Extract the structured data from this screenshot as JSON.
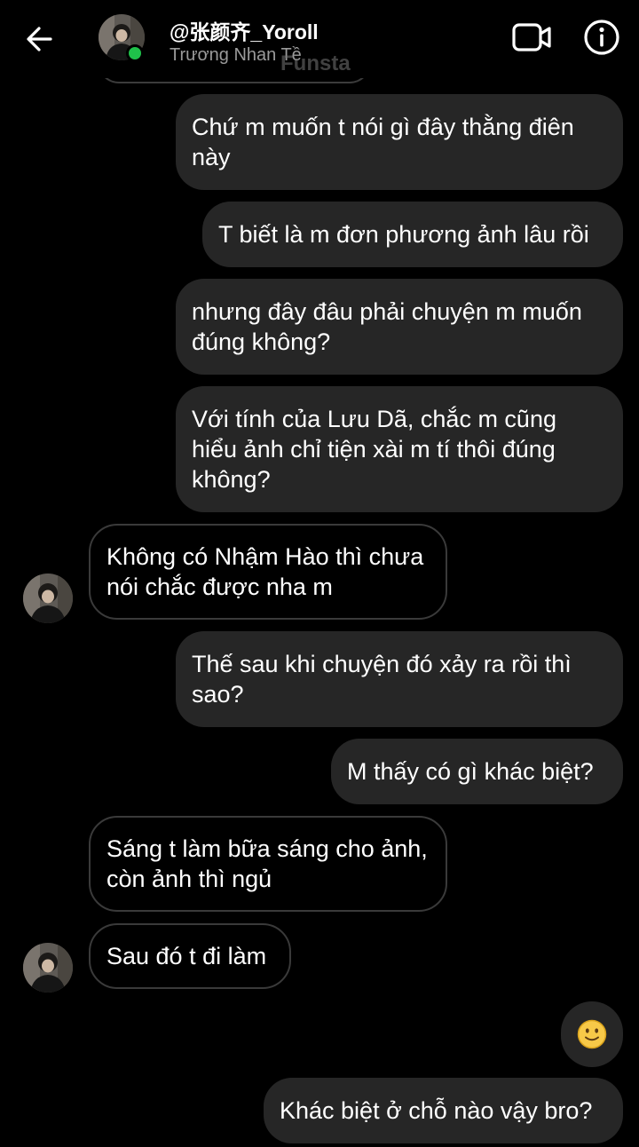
{
  "header": {
    "username": "@张颜齐_Yoroll",
    "subtitle": "Trương Nhan Tề",
    "watermark": "Funsta",
    "back_icon": "arrow-left-icon",
    "video_icon": "video-call-icon",
    "info_icon": "info-icon",
    "online_color": "#1fc14a"
  },
  "messages": [
    {
      "side": "out",
      "text": "Chứ m muốn t nói gì đây thằng điên này"
    },
    {
      "side": "out",
      "text": "T biết là m đơn phương ảnh lâu rồi"
    },
    {
      "side": "out",
      "text": "nhưng đây đâu phải chuyện m muốn đúng không?"
    },
    {
      "side": "out",
      "text": "Với tính của Lưu Dã, chắc m cũng hiểu ảnh chỉ tiện xài m tí thôi đúng không?"
    },
    {
      "side": "in",
      "text": "Không có Nhậm Hào thì chưa nói chắc được nha m"
    },
    {
      "side": "out",
      "text": "Thế sau khi chuyện đó xảy ra rồi thì sao?"
    },
    {
      "side": "out",
      "text": "M thấy có gì khác biệt?"
    },
    {
      "side": "in",
      "text": "Sáng t làm bữa sáng cho ảnh, còn ảnh thì ngủ"
    },
    {
      "side": "in",
      "text": "Sau đó t đi làm"
    },
    {
      "side": "out",
      "text": "🙂",
      "type": "emoji"
    },
    {
      "side": "out",
      "text": "Khác biệt ở chỗ nào vậy bro?"
    }
  ],
  "colors": {
    "background": "#000000",
    "outgoing_bubble": "#262626",
    "incoming_border": "#3a3a3a",
    "secondary_text": "#9a9a9a"
  }
}
